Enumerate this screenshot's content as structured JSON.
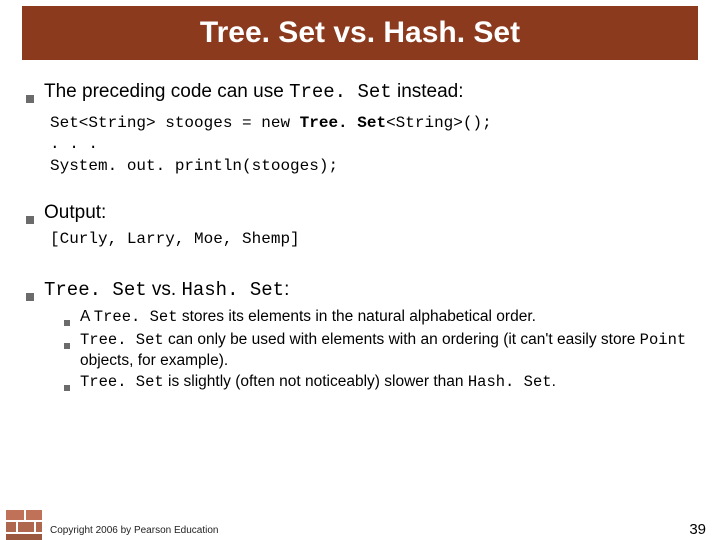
{
  "title": "Tree. Set vs. Hash. Set",
  "bullets": {
    "b1_pre": "The preceding code can use ",
    "b1_mono": "Tree. Set",
    "b1_post": " instead:"
  },
  "code": {
    "line1a": "Set<String> stooges = new ",
    "line1b": "Tree. Set",
    "line1c": "<String>();",
    "line2": ". . .",
    "line3": "System. out. println(stooges);"
  },
  "output_label": "Output:",
  "output_value": "[Curly, Larry, Moe, Shemp]",
  "compare": {
    "pre": "Tree. Set",
    "mid": " vs. ",
    "post": "Hash. Set",
    "tail": ":"
  },
  "sub": {
    "s1_a": "A ",
    "s1_b": "Tree. Set",
    "s1_c": " stores its elements in the natural alphabetical order.",
    "s2_a": "Tree. Set",
    "s2_b": " can only be used with elements with an ordering (it can't easily store ",
    "s2_c": "Point",
    "s2_d": " objects, for example).",
    "s3_a": "Tree. Set",
    "s3_b": " is slightly (often not noticeably) slower than ",
    "s3_c": "Hash. Set",
    "s3_d": "."
  },
  "copyright": "Copyright 2006 by Pearson Education",
  "page": "39"
}
